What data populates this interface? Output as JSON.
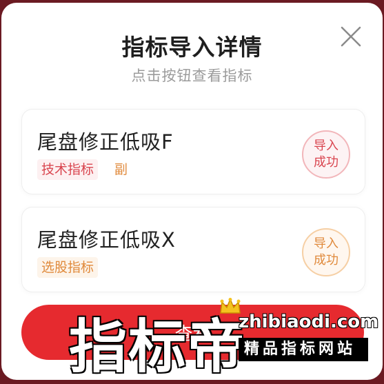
{
  "header": {
    "title": "指标导入详情",
    "subtitle": "点击按钮查看指标",
    "close_icon": "close-icon"
  },
  "items": [
    {
      "name": "尾盘修正低吸F",
      "tags": [
        "技术指标",
        "副"
      ],
      "status": "导入\n成功",
      "status_color": "#d9454f"
    },
    {
      "name": "尾盘修正低吸X",
      "tags": [
        "选股指标"
      ],
      "status": "导入\n成功",
      "status_color": "#e08a3c"
    }
  ],
  "footer": {
    "button_label": "查看"
  },
  "watermark": {
    "brand": "指标帝",
    "url": "zhibiaodi.com",
    "tagline": "精品指标网站"
  },
  "colors": {
    "accent": "#e62a2f",
    "tag_red": "#d9454f",
    "tag_orange": "#e08a3c"
  }
}
